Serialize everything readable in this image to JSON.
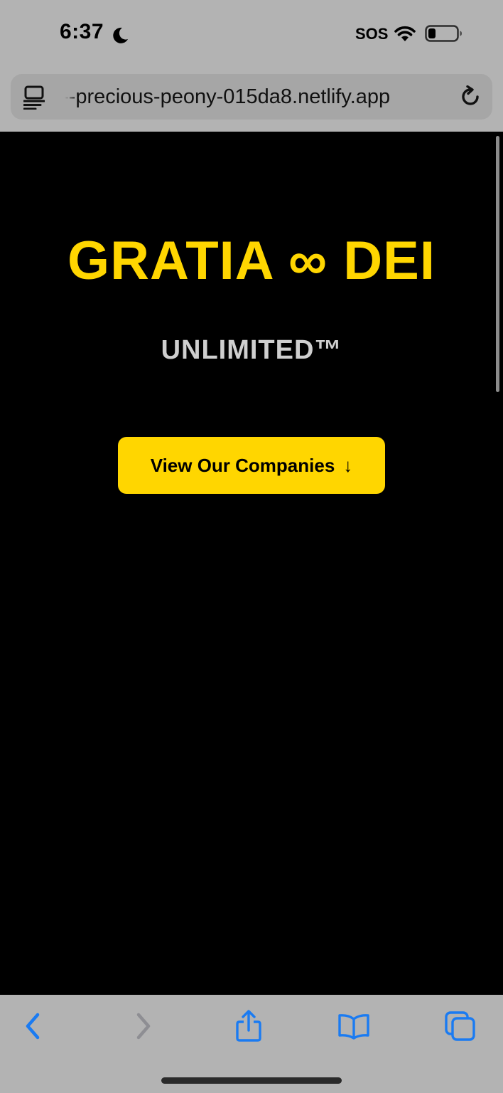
{
  "status_bar": {
    "time": "6:37",
    "sos": "SOS"
  },
  "browser": {
    "url": "--precious-peony-015da8.netlify.app"
  },
  "hero": {
    "title": "GRATIA ∞ DEI",
    "subtitle": "UNLIMITED™",
    "cta_label": "View Our Companies",
    "cta_arrow": "↓"
  },
  "colors": {
    "accent": "#FFD600",
    "background": "#000000",
    "browser_chrome": "#B3B3B3",
    "toolbar_icon": "#1A7BF2"
  },
  "toolbar": {
    "icons": [
      "back-icon",
      "forward-icon",
      "share-icon",
      "bookmarks-icon",
      "tabs-icon"
    ]
  }
}
